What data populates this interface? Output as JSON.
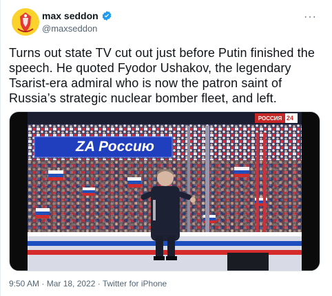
{
  "tweet": {
    "author_name": "max seddon",
    "author_handle": "@maxseddon",
    "text": "Turns out state TV cut out just before Putin finished the speech. He quoted Fyodor Ushakov, the legendary Tsarist-era admiral who is now the patron saint of Russia’s strategic nuclear bomber fleet, and left.",
    "timestamp": "9:50 AM · Mar 18, 2022 · Twitter for iPhone"
  },
  "media": {
    "banner_text": "ZA Россию",
    "channel_logo_text": "РОССИЯ",
    "channel_logo_number": "24"
  },
  "icons": {
    "verified": "verified-badge-icon",
    "more": "more-options-icon",
    "avatar": "avatar-crest-icon"
  },
  "colors": {
    "verified_blue": "#1d9bf0",
    "secondary_text": "#536471",
    "avatar_bg": "#fbd12d",
    "avatar_crest": "#e53935"
  }
}
